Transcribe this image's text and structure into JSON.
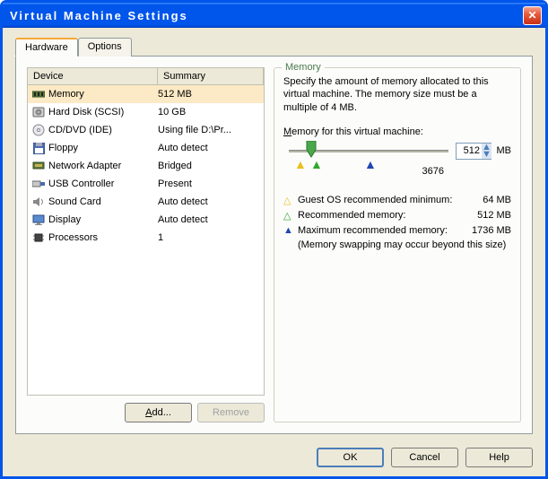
{
  "title": "Virtual Machine Settings",
  "tabs": {
    "hardware": "Hardware",
    "options": "Options"
  },
  "headers": {
    "device": "Device",
    "summary": "Summary"
  },
  "devices": [
    {
      "name": "Memory",
      "summary": "512 MB"
    },
    {
      "name": "Hard Disk (SCSI)",
      "summary": "10 GB"
    },
    {
      "name": "CD/DVD (IDE)",
      "summary": "Using file D:\\Pr..."
    },
    {
      "name": "Floppy",
      "summary": "Auto detect"
    },
    {
      "name": "Network Adapter",
      "summary": "Bridged"
    },
    {
      "name": "USB Controller",
      "summary": "Present"
    },
    {
      "name": "Sound Card",
      "summary": "Auto detect"
    },
    {
      "name": "Display",
      "summary": "Auto detect"
    },
    {
      "name": "Processors",
      "summary": "1"
    }
  ],
  "btns": {
    "add": "Add...",
    "remove": "Remove",
    "ok": "OK",
    "cancel": "Cancel",
    "help": "Help"
  },
  "mem": {
    "group": "Memory",
    "desc": "Specify the amount of memory allocated to this virtual machine. The memory size must be a multiple of 4 MB.",
    "label": "Memory for this virtual machine:",
    "value": "512",
    "unit": "MB",
    "max": "3676",
    "rec": [
      {
        "label": "Guest OS recommended minimum:",
        "val": "64 MB",
        "color": "#e8c11c"
      },
      {
        "label": "Recommended memory:",
        "val": "512 MB",
        "color": "#2fa82f"
      },
      {
        "label": "Maximum recommended memory:",
        "val": "1736 MB",
        "color": "#2046b0"
      }
    ],
    "note": "(Memory swapping may occur beyond this size)"
  }
}
